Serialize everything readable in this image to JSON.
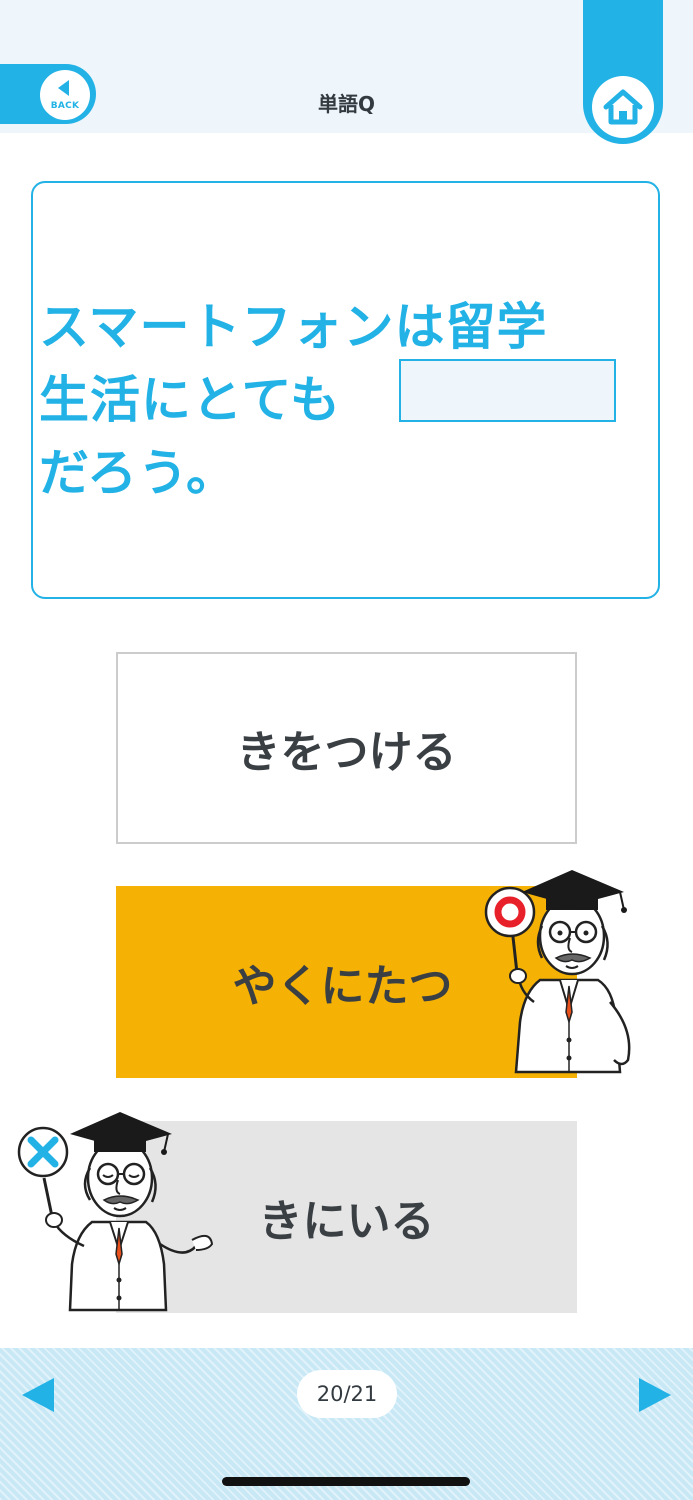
{
  "header": {
    "title": "単語Q",
    "back_label": "BACK",
    "back_icon": "back-arrow-icon",
    "home_icon": "home-icon"
  },
  "question": {
    "line1": "スマートフォンは留学",
    "line2": "生活にとても",
    "line3": "だろう。",
    "blank_value": ""
  },
  "choices": [
    {
      "label": "きをつける",
      "state": "unselected"
    },
    {
      "label": "やくにたつ",
      "state": "correct",
      "marker": "○"
    },
    {
      "label": "きにいる",
      "state": "incorrect",
      "marker": "×"
    }
  ],
  "footer": {
    "page": "20/21",
    "prev_icon": "prev-arrow-icon",
    "next_icon": "next-arrow-icon"
  },
  "colors": {
    "accent": "#22b2e6",
    "correct": "#f5b204",
    "incorrect": "#e5e5e5",
    "header_bg": "#eef6fc",
    "footer_bg": "#c8e8f6"
  }
}
